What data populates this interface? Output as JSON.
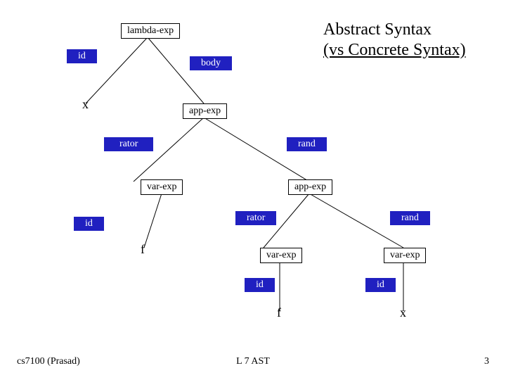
{
  "title_line1": "Abstract Syntax",
  "title_line2": "(vs Concrete Syntax)",
  "nodes": {
    "lambda_exp": "lambda-exp",
    "app_exp1": "app-exp",
    "app_exp2": "app-exp",
    "var_exp1": "var-exp",
    "var_exp2": "var-exp",
    "var_exp3": "var-exp"
  },
  "edges": {
    "id1": "id",
    "body": "body",
    "rator1": "rator",
    "rand1": "rand",
    "id2": "id",
    "rator2": "rator",
    "rand2": "rand",
    "id3": "id",
    "id4": "id"
  },
  "leaves": {
    "x1": "x",
    "f1": "f",
    "f2": "f",
    "x2": "x"
  },
  "footer": {
    "left": "cs7100 (Prasad)",
    "center": "L 7 AST",
    "right": "3"
  }
}
